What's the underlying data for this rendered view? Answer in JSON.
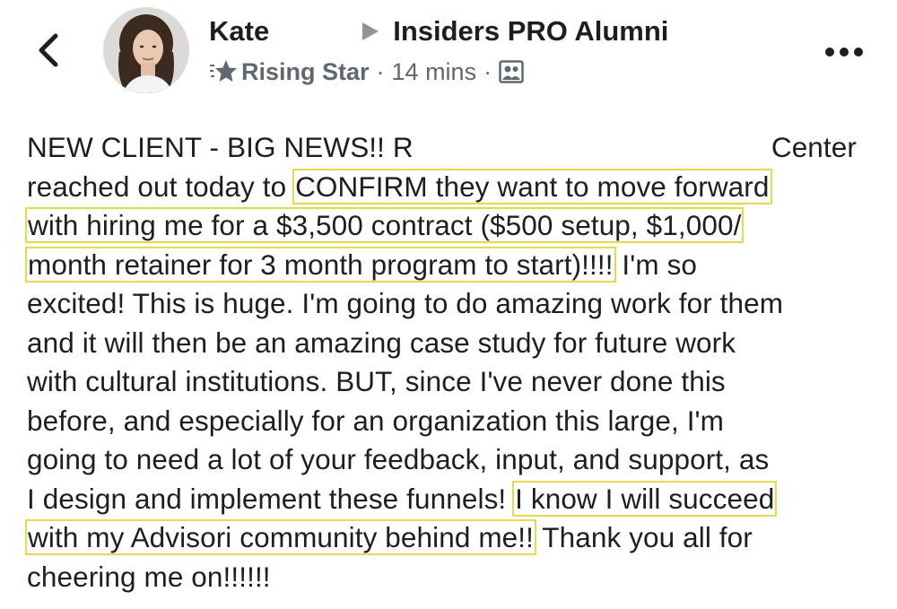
{
  "header": {
    "author_name": "Kate",
    "group_name": "Insiders PRO Alumni",
    "badge": "Rising Star",
    "separator": "·",
    "time": "14 mins",
    "icons": {
      "back": "chevron-left-icon",
      "arrow": "triangle-right-icon",
      "badge": "star-icon",
      "audience": "group-icon",
      "more": "more-dots-icon"
    }
  },
  "post": {
    "lines": [
      {
        "text": "NEW CLIENT - BIG NEWS!! R"
      },
      {
        "text": "Center"
      },
      {
        "pre": "reached out today to ",
        "hl": "CONFIRM they want to move forward"
      },
      {
        "hl": "with hiring me for a $3,500 contract ($500 setup, $1,000/"
      },
      {
        "hl": "month retainer for 3 month program to start)!!!!",
        "post": " I'm so"
      },
      {
        "text": "excited! This is huge. I'm going to do amazing work for them"
      },
      {
        "text": "and it will then be an amazing case study for future work"
      },
      {
        "text": "with cultural institutions. BUT, since I've never done this"
      },
      {
        "text": "before, and especially for an organization this large, I'm"
      },
      {
        "text": "going to need a lot of your feedback, input, and support, as"
      },
      {
        "pre": "I design and implement these funnels! ",
        "hl": "I know I will succeed"
      },
      {
        "hl": "with my Advisori community behind me!!",
        "post": " Thank you all for"
      },
      {
        "text": "cheering me on!!!!!!"
      }
    ]
  },
  "colors": {
    "text": "#1c1e21",
    "meta": "#606770",
    "highlight_border": "#e8d94a"
  }
}
